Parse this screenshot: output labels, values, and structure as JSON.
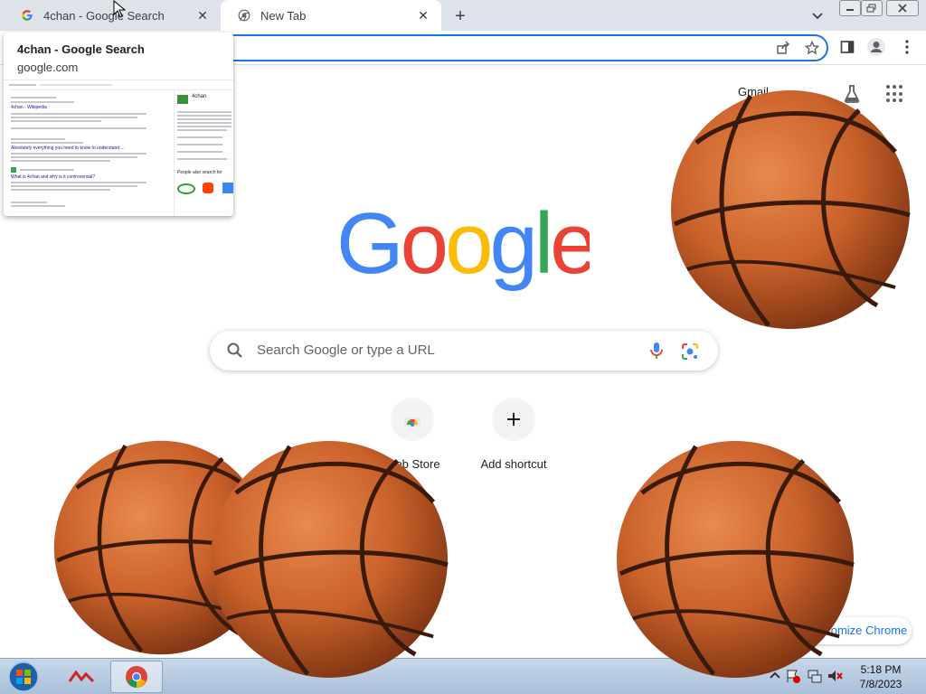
{
  "browser": {
    "tabs": [
      {
        "title": "4chan - Google Search",
        "favicon": "google-g-icon"
      },
      {
        "title": "New Tab",
        "favicon": "chrome-icon"
      }
    ]
  },
  "hover_card": {
    "title": "4chan - Google Search",
    "domain": "google.com",
    "preview": {
      "result_1_title": "4chan - Wikipedia",
      "result_2_title": "Absolutely everything you need to know to understand ...",
      "result_3_title": "What is 4chan and why is it controversial?",
      "panel_title": "4chan",
      "people_also_search": "People also search for"
    }
  },
  "ntp": {
    "gmail_link": "Gmail",
    "search_placeholder": "Search Google or type a URL",
    "shortcuts": [
      {
        "label": "Web Store",
        "icon": "webstore-icon"
      },
      {
        "label": "Add shortcut",
        "icon": "plus-icon"
      }
    ],
    "customize_label": "Customize Chrome"
  },
  "taskbar": {
    "time": "5:18 PM",
    "date": "7/8/2023"
  },
  "colors": {
    "google_blue": "#4285F4",
    "google_red": "#EA4335",
    "google_yellow": "#FBBC05",
    "google_green": "#34A853",
    "accent": "#1a73e8"
  }
}
